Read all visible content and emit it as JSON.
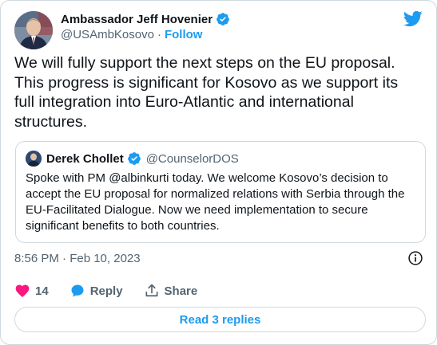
{
  "author": {
    "name": "Ambassador Jeff Hovenier",
    "handle": "@USAmbKosovo",
    "separator": "·",
    "follow_label": "Follow"
  },
  "tweet": {
    "text": "We will fully support the next steps on the EU proposal.\nThis progress is significant for Kosovo as we support its\nfull integration into Euro-Atlantic and international\nstructures.",
    "timestamp": "8:56 PM · Feb 10, 2023"
  },
  "quote": {
    "name": "Derek Chollet",
    "handle": "@CounselorDOS",
    "text": "Spoke with PM @albinkurti today. We welcome Kosovo’s decision to\naccept the EU proposal for normalized relations with Serbia through the\nEU-Facilitated Dialogue.  Now we need implementation to secure\nsignificant benefits to both countries."
  },
  "actions": {
    "like_count": "14",
    "reply_label": "Reply",
    "share_label": "Share"
  },
  "read_replies_label": "Read 3 replies",
  "colors": {
    "accent": "#1d9bf0",
    "like": "#f91880",
    "muted": "#536471",
    "border": "#cfd9de"
  },
  "icons": [
    "verified-badge-icon",
    "twitter-bird-icon",
    "info-icon",
    "heart-icon",
    "reply-bubble-icon",
    "share-icon"
  ]
}
